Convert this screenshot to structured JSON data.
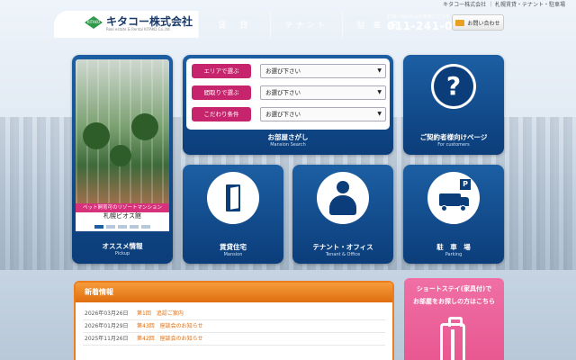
{
  "top_strip": "キタコー株式会社 ｜ 札幌賃貸・テナント・駐車場",
  "header": {
    "logo_mark": "KITAKO",
    "logo_text": "キタコー株式会社",
    "logo_sub": "Real estate & Rental KITAKO Co.,ltd.",
    "nav": [
      "賃　貸",
      "テナント",
      "駐 車 場"
    ],
    "contact_label": "お問い合わせはお気軽にどうぞ",
    "phone": "011-241-0635",
    "contact_button": "お問い合わせ"
  },
  "pickup": {
    "tag": "ペット飼育可のリゾートマンション",
    "name": "札幌ビオス館",
    "dots": 5,
    "active_dot": 0,
    "title": "オススメ情報",
    "subtitle": "Pickup"
  },
  "search": {
    "rows": [
      {
        "label": "エリアで選ぶ",
        "value": "お選び下さい"
      },
      {
        "label": "間取りで選ぶ",
        "value": "お選び下さい"
      },
      {
        "label": "こだわり条件",
        "value": "お選び下さい"
      }
    ],
    "title": "お部屋さがし",
    "subtitle": "Mansion Search"
  },
  "customers": {
    "title": "ご契約者様向けページ",
    "subtitle": "For customers",
    "icon_text": "?"
  },
  "mansion": {
    "title": "賃貸住宅",
    "subtitle": "Mansion"
  },
  "tenant": {
    "title": "テナント・オフィス",
    "subtitle": "Tenant & Office"
  },
  "parking": {
    "title": "駐　車　場",
    "subtitle": "Parking",
    "sign": "P"
  },
  "news": {
    "heading": "新着情報",
    "items": [
      {
        "date": "2026年03月26日",
        "title": "第1回　追認ご案内"
      },
      {
        "date": "2026年01月29日",
        "title": "第43回　座談会のお知らせ"
      },
      {
        "date": "2025年11月26日",
        "title": "第42回　座談会のお知らせ"
      }
    ]
  },
  "shortstay": {
    "line1": "ショートステイ(家具付)で",
    "line2": "お部屋をお探しの方はこちら"
  },
  "colors": {
    "primary": "#1c5fa3",
    "accent": "#c6256d",
    "news": "#ef7d1c"
  }
}
